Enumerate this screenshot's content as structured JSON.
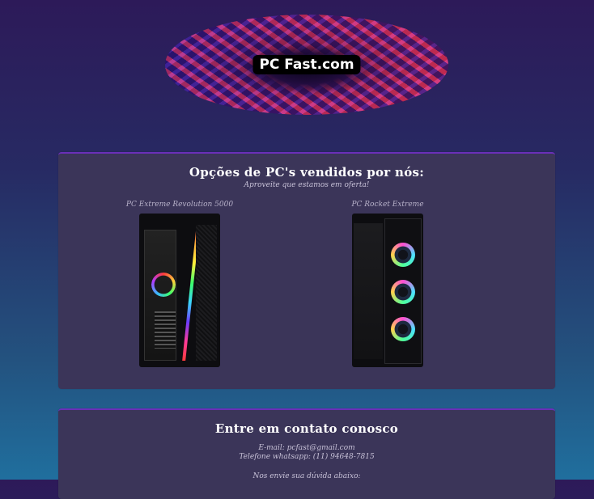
{
  "logo": {
    "text": "PC Fast.com"
  },
  "products_section": {
    "title": "Opções de PC's vendidos por nós:",
    "subtitle": "Aproveite que estamos em oferta!",
    "items": [
      {
        "name": "PC Extreme Revolution 5000"
      },
      {
        "name": "PC Rocket Extreme"
      }
    ]
  },
  "contact_section": {
    "title": "Entre em contato conosco",
    "email": "E-mail: pcfast@gmail.com",
    "phone": "Telefone whatsapp: (11) 94648-7815",
    "ask": "Nos envie sua dúvida abaixo:"
  },
  "colors": {
    "card_bg": "#3b3559",
    "accent": "#6a2fb8"
  }
}
